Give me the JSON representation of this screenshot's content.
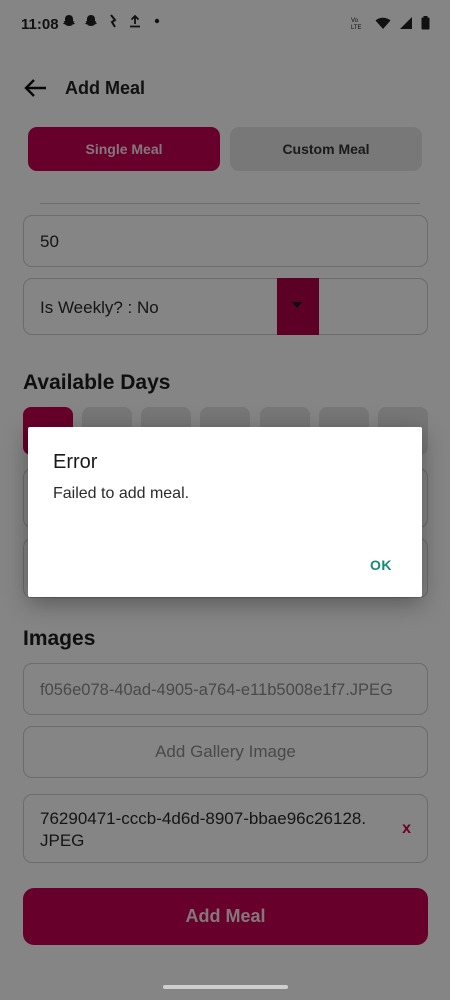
{
  "status_bar": {
    "time": "11:08",
    "left_icons": [
      "snapchat-icon",
      "snapchat-icon",
      "threads-icon",
      "upload-icon",
      "dot-icon"
    ],
    "right_icons": [
      "volte-icon",
      "wifi-icon",
      "signal-icon",
      "battery-icon"
    ]
  },
  "app_bar": {
    "title": "Add Meal"
  },
  "tabs": [
    {
      "label": "Single Meal",
      "selected": true
    },
    {
      "label": "Custom Meal",
      "selected": false
    }
  ],
  "form": {
    "price_value": "50",
    "weekly_label": "Is Weekly? : No",
    "available_days_title": "Available Days",
    "images_title": "Images",
    "image_1_name": "f056e078-40ad-4905-a764-e11b5008e1f7.JPEG",
    "gallery_button_label": "Add Gallery Image",
    "image_2_name": "76290471-cccb-4d6d-8907-bbae96c26128.\nJPEG",
    "remove_label": "x",
    "submit_label": "Add Meal"
  },
  "dialog": {
    "title": "Error",
    "message": "Failed to add meal.",
    "ok_label": "OK"
  },
  "colors": {
    "primary": "#c60052",
    "secondary_tab": "#e6e6e6",
    "dialog_button": "#168a77"
  }
}
